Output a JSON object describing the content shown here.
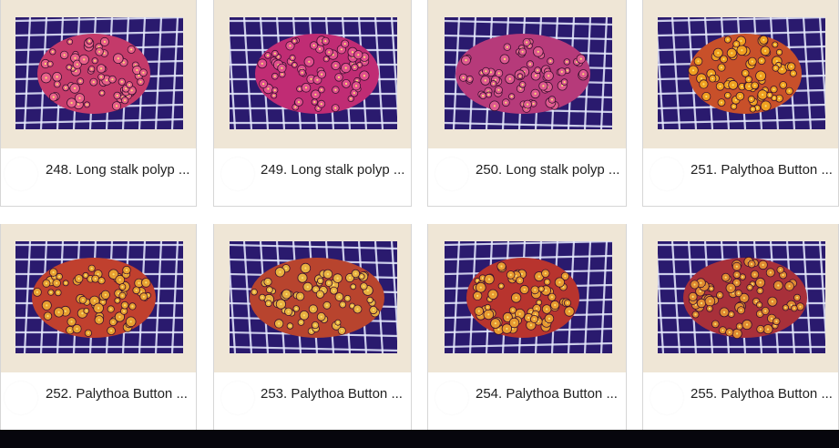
{
  "gallery": {
    "items": [
      {
        "title": "248. Long stalk polyp ...",
        "coral_color": "#c43a6a",
        "polyp_color": "#e8608a"
      },
      {
        "title": "249. Long stalk polyp ...",
        "coral_color": "#c02c74",
        "polyp_color": "#e0508e"
      },
      {
        "title": "250. Long stalk polyp ...",
        "coral_color": "#b63a7a",
        "polyp_color": "#de5a90"
      },
      {
        "title": "251. Palythoa Button ...",
        "coral_color": "#c8502a",
        "polyp_color": "#f0a020"
      },
      {
        "title": "252. Palythoa Button ...",
        "coral_color": "#c0402e",
        "polyp_color": "#e8a030"
      },
      {
        "title": "253. Palythoa Button ...",
        "coral_color": "#b8442e",
        "polyp_color": "#e8b040"
      },
      {
        "title": "254. Palythoa Button ...",
        "coral_color": "#b8342e",
        "polyp_color": "#e89a30"
      },
      {
        "title": "255. Palythoa Button ...",
        "coral_color": "#a8303a",
        "polyp_color": "#e08a30"
      }
    ]
  },
  "colors": {
    "card_background": "#efe6d6",
    "tank_blue": "#2a1a6e",
    "grid_white": "#e8ecff",
    "bottom_bar": "#07060d"
  }
}
